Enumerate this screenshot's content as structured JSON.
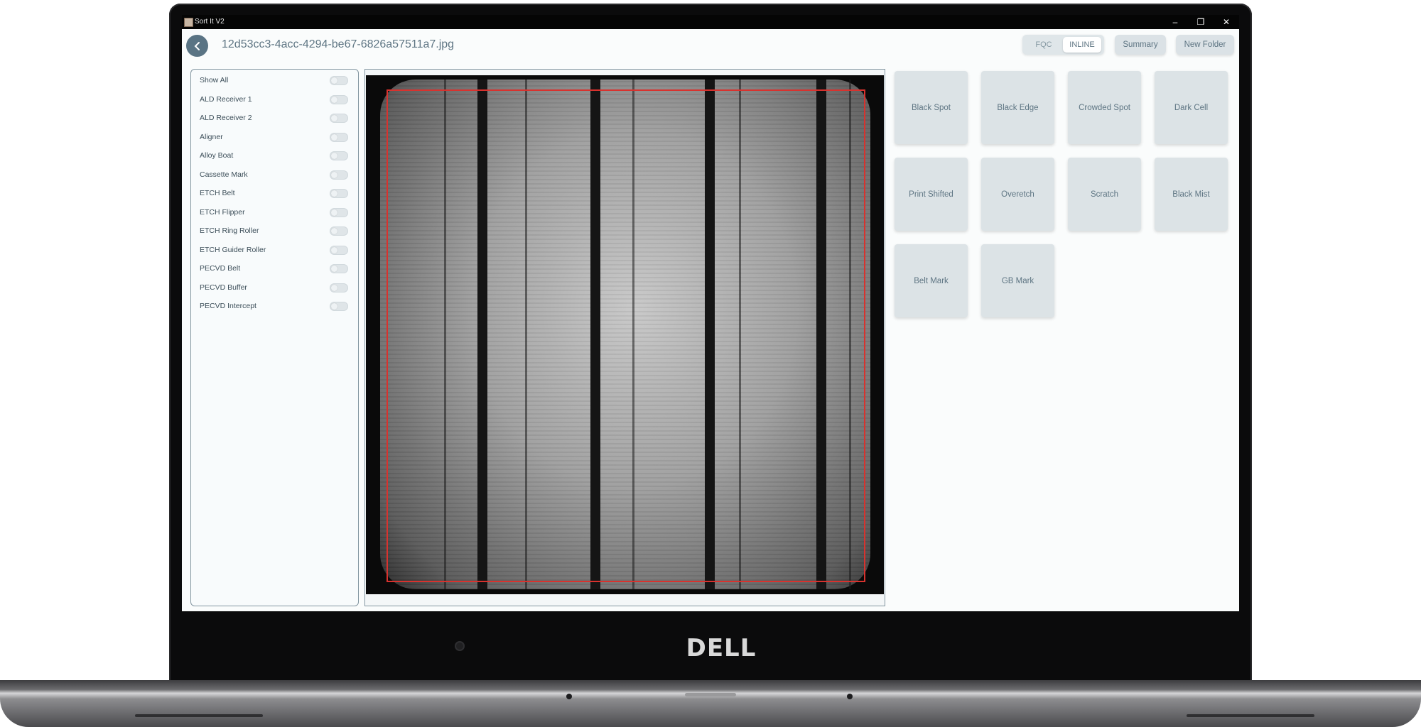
{
  "window": {
    "title": "Sort It V2",
    "controls": {
      "minimize": "–",
      "restore": "❐",
      "close": "✕"
    }
  },
  "header": {
    "file_name": "12d53cc3-4acc-4294-be67-6826a57511a7.jpg",
    "mode_toggle": {
      "options": [
        "FQC",
        "INLINE"
      ],
      "selected": "INLINE"
    },
    "summary_label": "Summary",
    "new_folder_label": "New Folder"
  },
  "filters": [
    {
      "label": "Show All",
      "enabled": false
    },
    {
      "label": "ALD Receiver 1",
      "enabled": false
    },
    {
      "label": "ALD Receiver 2",
      "enabled": false
    },
    {
      "label": "Aligner",
      "enabled": false
    },
    {
      "label": "Alloy Boat",
      "enabled": false
    },
    {
      "label": "Cassette Mark",
      "enabled": false
    },
    {
      "label": "ETCH Belt",
      "enabled": false
    },
    {
      "label": "ETCH Flipper",
      "enabled": false
    },
    {
      "label": "ETCH Ring Roller",
      "enabled": false
    },
    {
      "label": "ETCH Guider Roller",
      "enabled": false
    },
    {
      "label": "PECVD Belt",
      "enabled": false
    },
    {
      "label": "PECVD Buffer",
      "enabled": false
    },
    {
      "label": "PECVD Intercept",
      "enabled": false
    }
  ],
  "defects": [
    "Black Spot",
    "Black Edge",
    "Crowded Spot",
    "Dark Cell",
    "Print Shifted",
    "Overetch",
    "Scratch",
    "Black Mist",
    "Belt Mark",
    "GB Mark"
  ],
  "device": {
    "brand": "DELL"
  },
  "colors": {
    "accent": "#5a7484",
    "panel_border": "#8396a1",
    "button_bg": "#dce3e6",
    "roi_red": "#d8322e"
  }
}
